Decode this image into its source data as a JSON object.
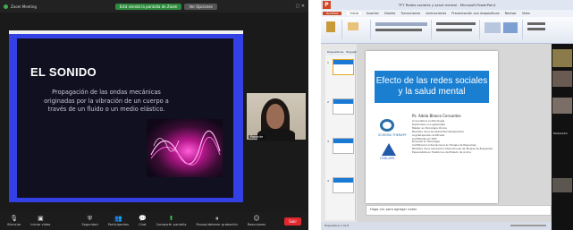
{
  "zoom_window": {
    "title": "Zoom Meeting",
    "recording_badge": "Está viendo la pantalla de Zoom",
    "options_badge": "Ver Opciones",
    "slide": {
      "title": "EL SONIDO",
      "body": "Propagación de las ondas mecánicas originadas por la vibración de un cuerpo a través de un fluido o un medio elástico."
    },
    "participant_name": "Ponente",
    "toolbar": [
      {
        "label": "Silenciar",
        "icon": "mic-icon"
      },
      {
        "label": "Iniciar video",
        "icon": "video-icon"
      },
      {
        "label": "Seguridad",
        "icon": "shield-icon"
      },
      {
        "label": "Participantes",
        "icon": "participants-icon"
      },
      {
        "label": "Chat",
        "icon": "chat-icon"
      },
      {
        "label": "Compartir pantalla",
        "icon": "share-icon"
      },
      {
        "label": "Pausar/detener grabación",
        "icon": "record-icon"
      },
      {
        "label": "Reacciones",
        "icon": "reactions-icon"
      }
    ],
    "end_button": "Salir"
  },
  "ppt_window": {
    "app_logo": "P",
    "title": "TFT Redes sociales y salud mental - Microsoft PowerPoint",
    "tabs": [
      "Archivo",
      "Inicio",
      "Insertar",
      "Diseño",
      "Transiciones",
      "Animaciones",
      "Presentación con diapositivas",
      "Revisar",
      "Vista"
    ],
    "panel_tabs": [
      "Diapositivas",
      "Esquema"
    ],
    "slide_numbers": [
      "1",
      "2",
      "3",
      "4"
    ],
    "slide": {
      "title": "Efecto de las redes sociales y la salud mental",
      "author": "Ps. Adela Blanco Cervantes",
      "logo1_caption": "SCHEMA THERAPY",
      "logo2_caption": "CEDLAPS",
      "bullets": [
        "Licenciatura en Psicología",
        "Diplomado en Logoterapia",
        "Máster en Psicología Clínica",
        "Miembro de la Sociedad Psicoterapéutica",
        "Logoterapeuta certificada",
        "Certificada por ISST",
        "Docente en Psicología",
        "Certificación Internacional en Terapia de Esquemas",
        "Miembro de la Asociación Internacional de Terapia de Esquemas",
        "Especialista en Trastornos del Estado de Ánimo"
      ]
    },
    "notes_placeholder": "Haga clic para agregar notas",
    "status": "Diapositiva 1 de 8",
    "side_name": "Moderador"
  },
  "colors": {
    "zoom_share_border": "#3340e6",
    "ppt_banner": "#1b7fd1",
    "end_button": "#e0282e"
  }
}
